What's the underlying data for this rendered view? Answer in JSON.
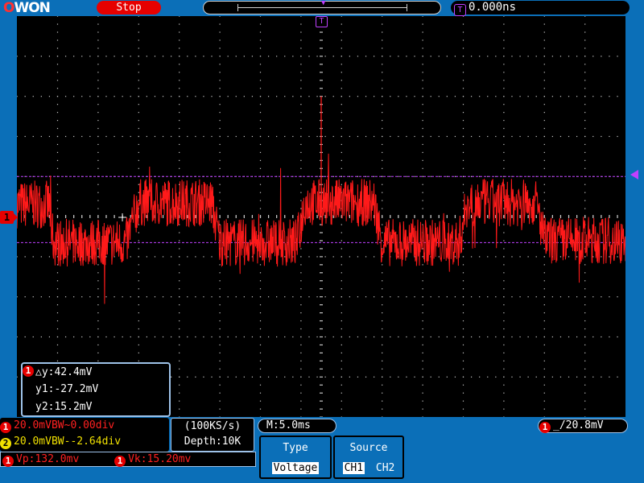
{
  "brand": {
    "logo_o": "O",
    "logo_rest": "WON"
  },
  "status": {
    "run_state": "Stop"
  },
  "timebase": {
    "trigger_time": "0.000ns",
    "trigger_badge": "T"
  },
  "markers": {
    "channel1": "1",
    "trigger_position": "T"
  },
  "cursor_readout": {
    "channel_badge": "1",
    "delta_y": "△y:42.4mV",
    "y1": "y1:-27.2mV",
    "y2": "y2:15.2mV"
  },
  "channels": [
    {
      "badge": "1",
      "setting": "20.0mVBW~0.00div",
      "color": "#ff2020"
    },
    {
      "badge": "2",
      "setting": "20.0mVBW--2.64div",
      "color": "#f0e000"
    }
  ],
  "acquisition": {
    "sample_rate": "(100KS/s)",
    "depth": "Depth:10K"
  },
  "horizontal": {
    "main_time": "M:5.0ms"
  },
  "trigger": {
    "badge": "1",
    "slope_symbol": "_/",
    "level": "20.8mV"
  },
  "measurements": [
    {
      "badge": "1",
      "text": "Vp:132.0mv"
    },
    {
      "badge": "1",
      "text": "Vk:15.20mv"
    }
  ],
  "menu": {
    "type": {
      "title": "Type",
      "selected": "Voltage"
    },
    "source": {
      "title": "Source",
      "options": [
        "CH1",
        "CH2"
      ],
      "selected": "CH1"
    }
  },
  "colors": {
    "trace": "#ff1a1a",
    "cursor_lines": "#c040ff",
    "frame": "#0b6fb8",
    "grid": "#c8c8c8"
  },
  "chart_data": {
    "type": "line",
    "xlabel": "",
    "ylabel": "",
    "x_divisions": 15,
    "y_divisions": 10,
    "x_div_units_range": [
      0,
      15
    ],
    "series": [
      {
        "x": [
          0,
          0.8,
          0.9,
          2.7,
          3.0,
          4.8,
          5.0,
          6.9,
          7.1,
          8.8,
          9.0,
          10.9,
          11.1,
          12.8,
          13.0,
          15.0
        ],
        "y": [
          0.3,
          0.3,
          -0.65,
          -0.65,
          0.35,
          0.35,
          -0.65,
          -0.65,
          0.35,
          0.35,
          -0.65,
          -0.65,
          0.35,
          0.35,
          -0.6,
          -0.6
        ]
      }
    ],
    "cursors_y_div": [
      1.0,
      -0.65
    ]
  }
}
